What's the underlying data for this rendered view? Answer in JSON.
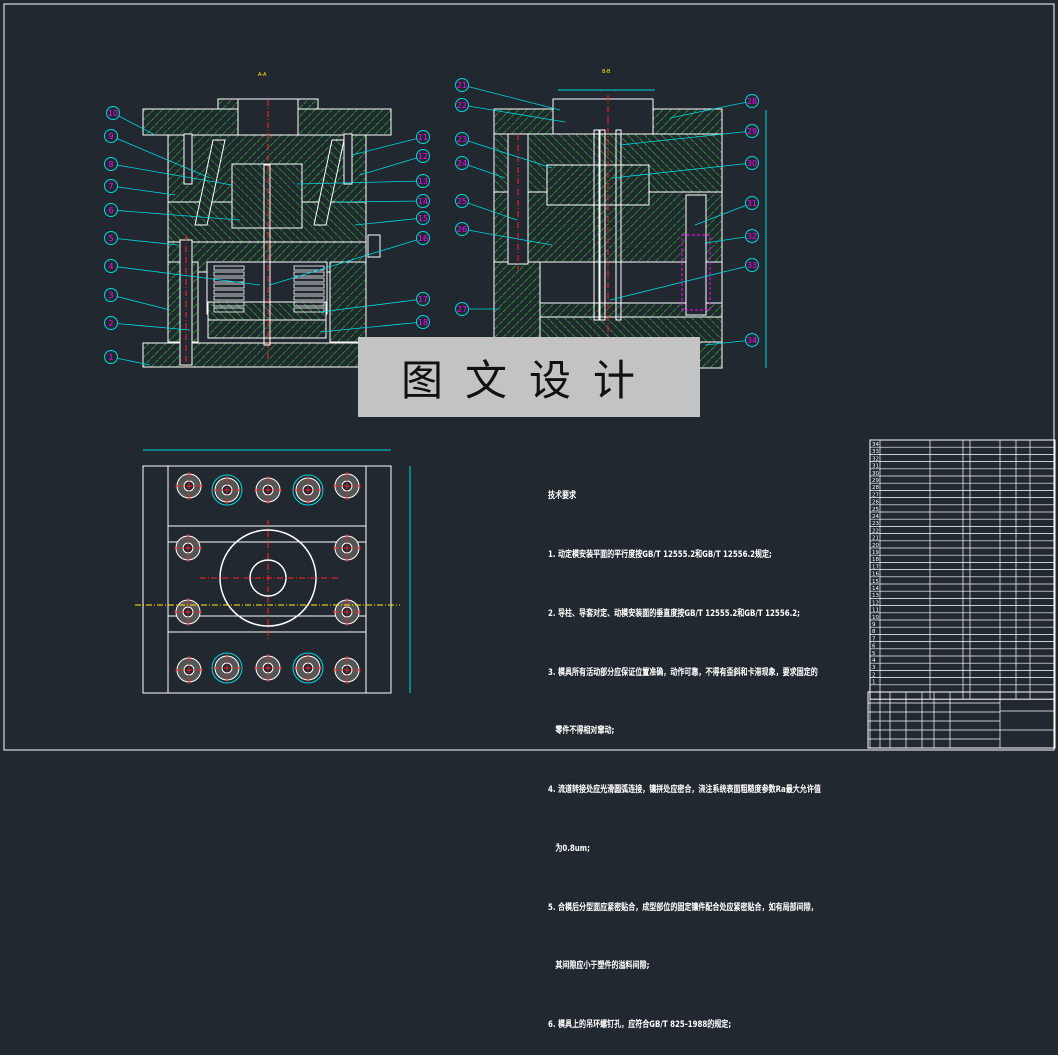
{
  "drawing": {
    "section_labels": [
      "A-A",
      "B-B"
    ],
    "left_balloons": [
      "10",
      "9",
      "8",
      "7",
      "6",
      "5",
      "4",
      "3",
      "2",
      "1"
    ],
    "right_balloons_view1": [
      "11",
      "12",
      "13",
      "14",
      "15",
      "16",
      "17",
      "18"
    ],
    "left_balloons_view2": [
      "21",
      "22",
      "23",
      "24",
      "25",
      "26",
      "27"
    ],
    "right_balloons_view2": [
      "28",
      "29",
      "30",
      "31",
      "32",
      "33",
      "34"
    ],
    "colors": {
      "background": "#212830",
      "hatch": "#22dd22",
      "outline": "#ffffff",
      "leader": "#00d8e0",
      "balloon_text": "#ff00ff",
      "centerline": "#ff2020",
      "section": "#ffee00"
    }
  },
  "watermark": "图文设计",
  "technical_requirements": {
    "title": "技术要求",
    "items": [
      "1. 动定模安装平面的平行度按GB/T 12555.2和GB/T 12556.2规定;",
      "2. 导柱、导套对定、动模安装面的垂直度按GB/T 12555.2和GB/T 12556.2;",
      "3. 模具所有活动部分应保证位置准确，动作可靠，不得有歪斜和卡滞现象，要求固定的",
      "   零件不得相对窜动;",
      "4. 流道转接处应光滑圆弧连接，镶拼处应密合，浇注系统表面粗糙度参数Ra最大允许值",
      "   为0.8um;",
      "5. 合模后分型面应紧密贴合，成型部位的固定镶件配合处应紧密贴合，如有局部间隙，",
      "   其间隙应小于塑件的溢料间隙;",
      "6. 模具上的吊环螺钉孔，应符合GB/T 825-1988的规定;"
    ]
  },
  "parts_list": {
    "row_numbers": [
      "34",
      "33",
      "32",
      "31",
      "30",
      "29",
      "28",
      "27",
      "26",
      "25",
      "24",
      "23",
      "22",
      "21",
      "20",
      "19",
      "18",
      "17",
      "16",
      "15",
      "14",
      "13",
      "12",
      "11",
      "10",
      "9",
      "8",
      "7",
      "6",
      "5",
      "4",
      "3",
      "2",
      "1"
    ]
  }
}
